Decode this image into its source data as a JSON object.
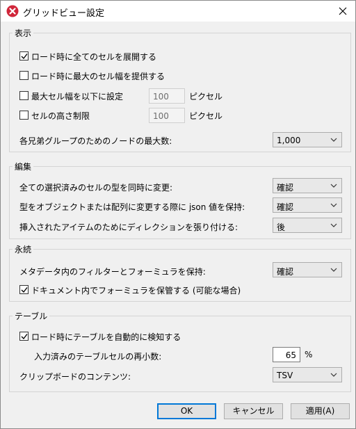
{
  "window": {
    "title": "グリッドビュー設定"
  },
  "display": {
    "legend": "表示",
    "expand_cells": "ロード時に全てのセルを展開する",
    "max_width_on_load": "ロード時に最大のセル幅を提供する",
    "set_max_width": "最大セル幅を以下に設定",
    "set_max_width_value": "100",
    "set_max_width_unit": "ピクセル",
    "limit_height": "セルの高さ制限",
    "limit_height_value": "100",
    "limit_height_unit": "ピクセル",
    "max_nodes_label": "各兄弟グループのためのノードの最大数:",
    "max_nodes_value": "1,000"
  },
  "edit": {
    "legend": "編集",
    "change_type_label": "全ての選択済みのセルの型を同時に変更:",
    "change_type_value": "確認",
    "keep_json_label": "型をオブジェクトまたは配列に変更する際に json 値を保持:",
    "keep_json_value": "確認",
    "append_dir_label": "挿入されたアイテムのためにディレクションを張り付ける:",
    "append_dir_value": "後"
  },
  "persist": {
    "legend": "永続",
    "keep_filters_label": "メタデータ内のフィルターとフォーミュラを保持:",
    "keep_filters_value": "確認",
    "store_formulas": "ドキュメント内でフォーミュラを保管する (可能な場合)"
  },
  "table": {
    "legend": "テーブル",
    "auto_detect": "ロード時にテーブルを自動的に検知する",
    "decimals_label": "入力済みのテーブルセルの再小数:",
    "decimals_value": "65",
    "decimals_unit": "%",
    "clipboard_label": "クリップボードのコンテンツ:",
    "clipboard_value": "TSV"
  },
  "buttons": {
    "ok": "OK",
    "cancel": "キャンセル",
    "apply": "適用(A)"
  },
  "colors": {
    "accent": "#0078d7",
    "icon_red": "#d0263a"
  }
}
